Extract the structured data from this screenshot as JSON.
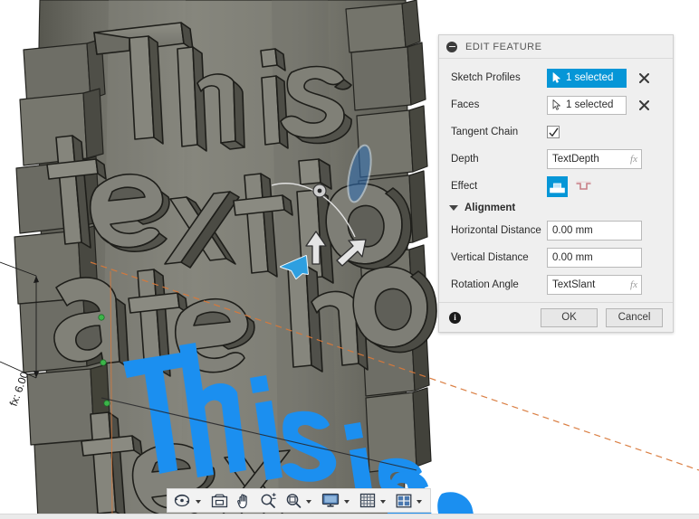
{
  "app": {
    "viewport_background": "#ffffff",
    "model_color": "#77776f",
    "accent": "#0696d7",
    "selection_blue": "#1b8ff0",
    "construction_orange": "#d9793a"
  },
  "viewport": {
    "model_text_lines": [
      "This",
      "text is",
      "ate ho",
      "tex"
    ],
    "highlighted_sketch_text": "This is tex",
    "dimension_label": "fx: 6.00",
    "manipulator": {
      "origin_handle": "origin-point",
      "vertical_arrow": "translate-up-arrow",
      "horizontal_arrow": "translate-right-arrow",
      "rotation_handle": "rotation-ellipse-handle"
    },
    "cursor": "arrow-cursor"
  },
  "panel": {
    "title": "EDIT FEATURE",
    "collapse_icon": "collapse-minus-icon",
    "rows": [
      {
        "label": "Sketch Profiles",
        "value": "1 selected",
        "active": true,
        "icon": "selection-cursor-icon",
        "clear_icon": "close-x-icon"
      },
      {
        "label": "Faces",
        "value": "1 selected",
        "active": false,
        "icon": "selection-cursor-icon",
        "clear_icon": "close-x-icon"
      }
    ],
    "tangent_chain": {
      "label": "Tangent Chain",
      "checked": true,
      "icon": "checkmark-icon"
    },
    "depth": {
      "label": "Depth",
      "value": "TextDepth",
      "fx": "fx"
    },
    "effect": {
      "label": "Effect",
      "options": [
        {
          "name": "emboss-effect-icon",
          "selected": true
        },
        {
          "name": "engrave-effect-icon",
          "selected": false
        }
      ]
    },
    "alignment": {
      "label": "Alignment",
      "expanded": true,
      "fields": [
        {
          "label": "Horizontal Distance",
          "value": "0.00 mm",
          "fx": ""
        },
        {
          "label": "Vertical Distance",
          "value": "0.00 mm",
          "fx": ""
        },
        {
          "label": "Rotation Angle",
          "value": "TextSlant",
          "fx": "fx"
        }
      ]
    },
    "footer": {
      "info_icon": "info-icon",
      "info_glyph": "i",
      "ok_label": "OK",
      "cancel_label": "Cancel"
    }
  },
  "nav_toolbar": {
    "items": [
      {
        "name": "orbit-icon",
        "caret": true
      },
      {
        "name": "zoom-window-icon",
        "caret": false
      },
      {
        "name": "pan-hand-icon",
        "caret": false
      },
      {
        "name": "zoom-icon",
        "caret": false
      },
      {
        "name": "fit-icon",
        "caret": true
      },
      {
        "name": "display-settings-icon",
        "caret": true
      },
      {
        "name": "grid-snap-icon",
        "caret": true
      },
      {
        "name": "viewports-icon",
        "caret": true
      }
    ]
  }
}
